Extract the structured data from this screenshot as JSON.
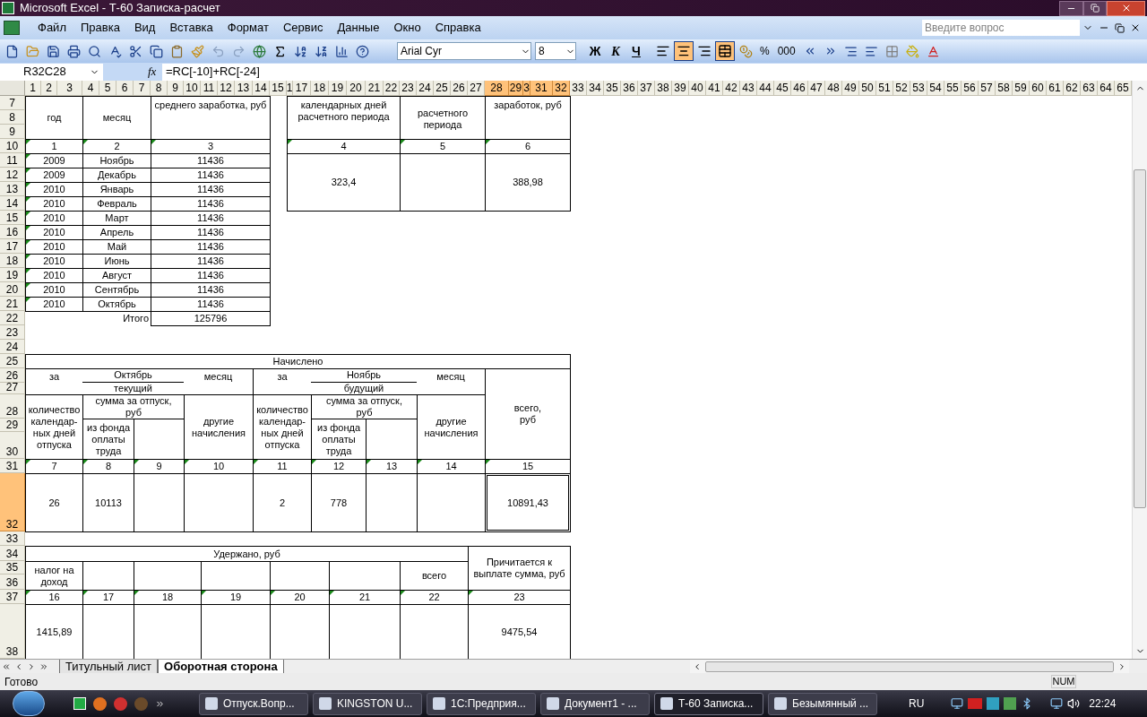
{
  "window": {
    "title": "Microsoft Excel - Т-60 Записка-расчет"
  },
  "menu": [
    "Файл",
    "Правка",
    "Вид",
    "Вставка",
    "Формат",
    "Сервис",
    "Данные",
    "Окно",
    "Справка"
  ],
  "help_box": {
    "placeholder": "Введите вопрос"
  },
  "format_toolbar": {
    "font": "Arial Cyr",
    "size": "8",
    "style_buttons": [
      "Ж",
      "К",
      "Ч"
    ],
    "align_buttons": [
      {
        "kind": "left",
        "selected": false
      },
      {
        "kind": "center",
        "selected": true
      },
      {
        "kind": "right",
        "selected": false
      },
      {
        "kind": "merge",
        "selected": true
      }
    ],
    "number_buttons": [
      "%",
      "000"
    ]
  },
  "formula_bar": {
    "name_box": "R32C28",
    "function_label": "fx",
    "formula": "=RC[-10]+RC[-24]"
  },
  "columns": [
    {
      "label": "1",
      "selected": false
    },
    {
      "label": "2",
      "selected": false
    },
    {
      "label": "3",
      "selected": false
    },
    {
      "label": "4",
      "selected": false
    },
    {
      "label": "5",
      "selected": false
    },
    {
      "label": "6",
      "selected": false
    },
    {
      "label": "7",
      "selected": false
    },
    {
      "label": "8",
      "selected": false
    },
    {
      "label": "9",
      "selected": false
    },
    {
      "label": "10",
      "selected": false
    },
    {
      "label": "11",
      "selected": false
    },
    {
      "label": "12",
      "selected": false
    },
    {
      "label": "13",
      "selected": false
    },
    {
      "label": "14",
      "selected": false
    },
    {
      "label": "15",
      "selected": false
    },
    {
      "label": "1",
      "selected": false
    },
    {
      "label": "17",
      "selected": false
    },
    {
      "label": "18",
      "selected": false
    },
    {
      "label": "19",
      "selected": false
    },
    {
      "label": "20",
      "selected": false
    },
    {
      "label": "21",
      "selected": false
    },
    {
      "label": "22",
      "selected": false
    },
    {
      "label": "23",
      "selected": false
    },
    {
      "label": "24",
      "selected": false
    },
    {
      "label": "25",
      "selected": false
    },
    {
      "label": "26",
      "selected": false
    },
    {
      "label": "27",
      "selected": false
    },
    {
      "label": "28",
      "selected": true
    },
    {
      "label": "29",
      "selected": true
    },
    {
      "label": "3",
      "selected": true
    },
    {
      "label": "31",
      "selected": true
    },
    {
      "label": "32",
      "selected": true
    },
    {
      "label": "33",
      "selected": false
    },
    {
      "label": "34",
      "selected": false
    },
    {
      "label": "35",
      "selected": false
    },
    {
      "label": "36",
      "selected": false
    },
    {
      "label": "37",
      "selected": false
    },
    {
      "label": "38",
      "selected": false
    },
    {
      "label": "39",
      "selected": false
    },
    {
      "label": "40",
      "selected": false
    },
    {
      "label": "41",
      "selected": false
    },
    {
      "label": "42",
      "selected": false
    },
    {
      "label": "43",
      "selected": false
    },
    {
      "label": "44",
      "selected": false
    },
    {
      "label": "45",
      "selected": false
    },
    {
      "label": "46",
      "selected": false
    },
    {
      "label": "47",
      "selected": false
    },
    {
      "label": "48",
      "selected": false
    },
    {
      "label": "49",
      "selected": false
    },
    {
      "label": "50",
      "selected": false
    },
    {
      "label": "51",
      "selected": false
    },
    {
      "label": "52",
      "selected": false
    },
    {
      "label": "53",
      "selected": false
    },
    {
      "label": "54",
      "selected": false
    },
    {
      "label": "55",
      "selected": false
    },
    {
      "label": "56",
      "selected": false
    },
    {
      "label": "57",
      "selected": false
    },
    {
      "label": "58",
      "selected": false
    },
    {
      "label": "59",
      "selected": false
    },
    {
      "label": "60",
      "selected": false
    },
    {
      "label": "61",
      "selected": false
    },
    {
      "label": "62",
      "selected": false
    },
    {
      "label": "63",
      "selected": false
    },
    {
      "label": "64",
      "selected": false
    },
    {
      "label": "65",
      "selected": false
    }
  ],
  "rows": [
    {
      "label": "7",
      "selected": false
    },
    {
      "label": "8",
      "selected": false
    },
    {
      "label": "9",
      "selected": false
    },
    {
      "label": "10",
      "selected": false
    },
    {
      "label": "11",
      "selected": false
    },
    {
      "label": "12",
      "selected": false
    },
    {
      "label": "13",
      "selected": false
    },
    {
      "label": "14",
      "selected": false
    },
    {
      "label": "15",
      "selected": false
    },
    {
      "label": "16",
      "selected": false
    },
    {
      "label": "17",
      "selected": false
    },
    {
      "label": "18",
      "selected": false
    },
    {
      "label": "19",
      "selected": false
    },
    {
      "label": "20",
      "selected": false
    },
    {
      "label": "21",
      "selected": false
    },
    {
      "label": "22",
      "selected": false
    },
    {
      "label": "23",
      "selected": false
    },
    {
      "label": "24",
      "selected": false
    },
    {
      "label": "25",
      "selected": false
    },
    {
      "label": "26",
      "selected": false
    },
    {
      "label": "27",
      "selected": false
    },
    {
      "label": "28",
      "selected": false
    },
    {
      "label": "29",
      "selected": false
    },
    {
      "label": "30",
      "selected": false
    },
    {
      "label": "31",
      "selected": false
    },
    {
      "label": "32",
      "selected": true
    },
    {
      "label": "33",
      "selected": false
    },
    {
      "label": "34",
      "selected": false
    },
    {
      "label": "35",
      "selected": false
    },
    {
      "label": "36",
      "selected": false
    },
    {
      "label": "37",
      "selected": false
    },
    {
      "label": "38",
      "selected": false
    }
  ],
  "cells": [
    {
      "text": "год",
      "flag": false,
      "selected": false
    },
    {
      "text": "месяц",
      "flag": false,
      "selected": false
    },
    {
      "text": "среднего заработка, руб",
      "flag": false,
      "selected": false
    },
    {
      "text": "календарных дней расчетного периода",
      "flag": false,
      "selected": false
    },
    {
      "text": "расчетного периода",
      "flag": false,
      "selected": false
    },
    {
      "text": "заработок, руб",
      "flag": false,
      "selected": false
    },
    {
      "text": "1",
      "flag": true,
      "selected": false
    },
    {
      "text": "2",
      "flag": true,
      "selected": false
    },
    {
      "text": "3",
      "flag": true,
      "selected": false
    },
    {
      "text": "4",
      "flag": true,
      "selected": false
    },
    {
      "text": "5",
      "flag": true,
      "selected": false
    },
    {
      "text": "6",
      "flag": true,
      "selected": false
    },
    {
      "text": "2009",
      "flag": true,
      "selected": false
    },
    {
      "text": "Ноябрь",
      "flag": false,
      "selected": false
    },
    {
      "text": "11436",
      "flag": false,
      "selected": false
    },
    {
      "text": "2009",
      "flag": true,
      "selected": false
    },
    {
      "text": "Декабрь",
      "flag": false,
      "selected": false
    },
    {
      "text": "11436",
      "flag": false,
      "selected": false
    },
    {
      "text": "2010",
      "flag": true,
      "selected": false
    },
    {
      "text": "Январь",
      "flag": false,
      "selected": false
    },
    {
      "text": "11436",
      "flag": false,
      "selected": false
    },
    {
      "text": "2010",
      "flag": true,
      "selected": false
    },
    {
      "text": "Февраль",
      "flag": false,
      "selected": false
    },
    {
      "text": "11436",
      "flag": false,
      "selected": false
    },
    {
      "text": "2010",
      "flag": true,
      "selected": false
    },
    {
      "text": "Март",
      "flag": false,
      "selected": false
    },
    {
      "text": "11436",
      "flag": false,
      "selected": false
    },
    {
      "text": "2010",
      "flag": true,
      "selected": false
    },
    {
      "text": "Апрель",
      "flag": false,
      "selected": false
    },
    {
      "text": "11436",
      "flag": false,
      "selected": false
    },
    {
      "text": "2010",
      "flag": true,
      "selected": false
    },
    {
      "text": "Май",
      "flag": false,
      "selected": false
    },
    {
      "text": "11436",
      "flag": false,
      "selected": false
    },
    {
      "text": "2010",
      "flag": true,
      "selected": false
    },
    {
      "text": "Июнь",
      "flag": false,
      "selected": false
    },
    {
      "text": "11436",
      "flag": false,
      "selected": false
    },
    {
      "text": "2010",
      "flag": true,
      "selected": false
    },
    {
      "text": "Август",
      "flag": false,
      "selected": false
    },
    {
      "text": "11436",
      "flag": false,
      "selected": false
    },
    {
      "text": "2010",
      "flag": true,
      "selected": false
    },
    {
      "text": "Сентябрь",
      "flag": false,
      "selected": false
    },
    {
      "text": "11436",
      "flag": false,
      "selected": false
    },
    {
      "text": "2010",
      "flag": true,
      "selected": false
    },
    {
      "text": "Октябрь",
      "flag": false,
      "selected": false
    },
    {
      "text": "11436",
      "flag": false,
      "selected": false
    },
    {
      "text": "323,4",
      "flag": false,
      "selected": false
    },
    {
      "text": "388,98",
      "flag": false,
      "selected": false
    },
    {
      "text": "Итого",
      "flag": false,
      "selected": false
    },
    {
      "text": "125796",
      "flag": false,
      "selected": false
    },
    {
      "text": "Начислено",
      "flag": false,
      "selected": false
    },
    {
      "text": "за",
      "flag": false,
      "selected": false
    },
    {
      "text": "Октябрь",
      "flag": false,
      "selected": false
    },
    {
      "text": "текущий",
      "flag": false,
      "selected": false
    },
    {
      "text": "месяц",
      "flag": false,
      "selected": false
    },
    {
      "text": "за",
      "flag": false,
      "selected": false
    },
    {
      "text": "Ноябрь",
      "flag": false,
      "selected": false
    },
    {
      "text": "будущий",
      "flag": false,
      "selected": false
    },
    {
      "text": "месяц",
      "flag": false,
      "selected": false
    },
    {
      "text": "количество календар-ных дней отпуска",
      "flag": false,
      "selected": false
    },
    {
      "text": "сумма за отпуск, руб",
      "flag": false,
      "selected": false
    },
    {
      "text": "из фонда оплаты труда",
      "flag": false,
      "selected": false
    },
    {
      "text": "другие начисления",
      "flag": false,
      "selected": false
    },
    {
      "text": "количество календар-ных дней отпуска",
      "flag": false,
      "selected": false
    },
    {
      "text": "сумма за отпуск, руб",
      "flag": false,
      "selected": false
    },
    {
      "text": "из фонда оплаты труда",
      "flag": false,
      "selected": false
    },
    {
      "text": "другие начисления",
      "flag": false,
      "selected": false
    },
    {
      "text": "всего, руб",
      "flag": false,
      "selected": false
    },
    {
      "text": "7",
      "flag": true,
      "selected": false
    },
    {
      "text": "8",
      "flag": true,
      "selected": false
    },
    {
      "text": "9",
      "flag": true,
      "selected": false
    },
    {
      "text": "10",
      "flag": true,
      "selected": false
    },
    {
      "text": "11",
      "flag": true,
      "selected": false
    },
    {
      "text": "12",
      "flag": true,
      "selected": false
    },
    {
      "text": "13",
      "flag": true,
      "selected": false
    },
    {
      "text": "14",
      "flag": true,
      "selected": false
    },
    {
      "text": "15",
      "flag": true,
      "selected": false
    },
    {
      "text": "26",
      "flag": false,
      "selected": false
    },
    {
      "text": "10113",
      "flag": false,
      "selected": false
    },
    {
      "text": "2",
      "flag": false,
      "selected": false
    },
    {
      "text": "778",
      "flag": false,
      "selected": false
    },
    {
      "text": "10891,43",
      "flag": false,
      "selected": true
    },
    {
      "text": "Удержано, руб",
      "flag": false,
      "selected": false
    },
    {
      "text": "Причитается к выплате сумма, руб",
      "flag": false,
      "selected": false
    },
    {
      "text": "налог на доход",
      "flag": false,
      "selected": false
    },
    {
      "text": "всего",
      "flag": false,
      "selected": false
    },
    {
      "text": "16",
      "flag": true,
      "selected": false
    },
    {
      "text": "17",
      "flag": true,
      "selected": false
    },
    {
      "text": "18",
      "flag": true,
      "selected": false
    },
    {
      "text": "19",
      "flag": true,
      "selected": false
    },
    {
      "text": "20",
      "flag": true,
      "selected": false
    },
    {
      "text": "21",
      "flag": true,
      "selected": false
    },
    {
      "text": "22",
      "flag": true,
      "selected": false
    },
    {
      "text": "23",
      "flag": true,
      "selected": false
    },
    {
      "text": "1415,89",
      "flag": false,
      "selected": false
    },
    {
      "text": "9475,54",
      "flag": false,
      "selected": false
    }
  ],
  "sheet_tabs": [
    {
      "label": "Титульный лист",
      "selected": false
    },
    {
      "label": "Оборотная сторона",
      "selected": true
    }
  ],
  "status_bar": {
    "text": "Готово",
    "indicators": [
      "NUM"
    ]
  },
  "taskbar": {
    "buttons": [
      {
        "label": "Отпуск.Вопр...",
        "selected": false
      },
      {
        "label": "KINGSTON U...",
        "selected": false
      },
      {
        "label": "1С:Предприя...",
        "selected": false
      },
      {
        "label": "Документ1 - ...",
        "selected": false
      },
      {
        "label": "Т-60 Записка...",
        "selected": true
      },
      {
        "label": "Безымянный ...",
        "selected": false
      }
    ],
    "language": "RU",
    "clock": "22:24"
  }
}
